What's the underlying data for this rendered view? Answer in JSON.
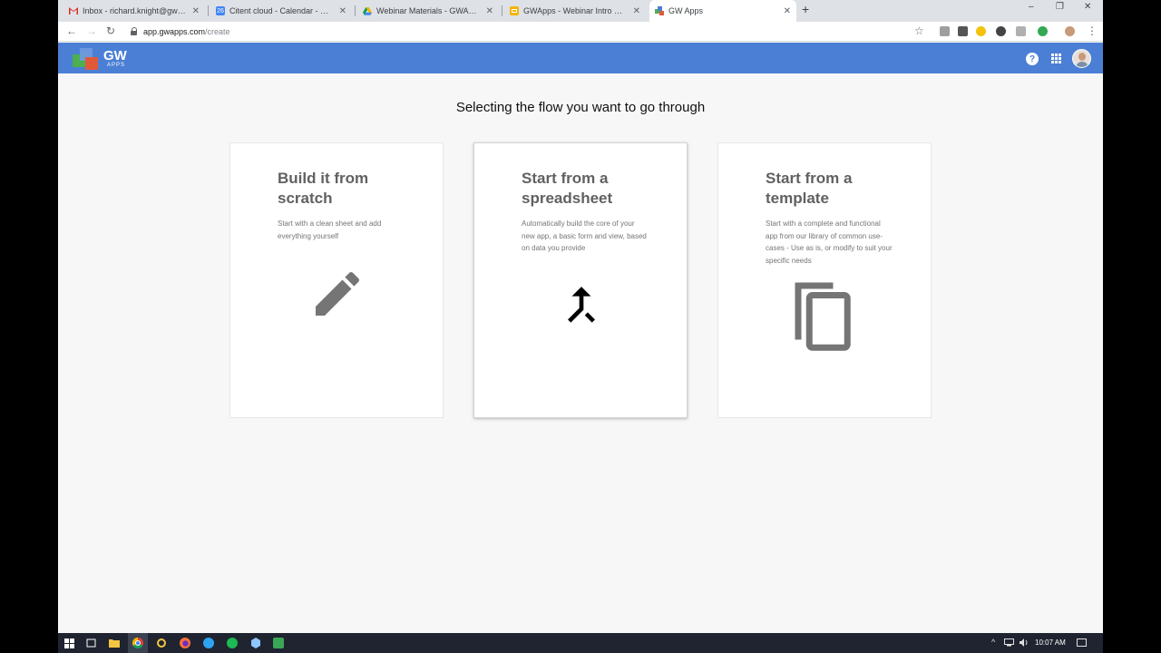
{
  "browser": {
    "tabs": [
      {
        "title": "Inbox - richard.knight@gwapps.c",
        "icon": "gmail-icon",
        "color": "#d93025",
        "active": false
      },
      {
        "title": "Citent cloud - Calendar - Week o",
        "icon": "calendar-icon",
        "color": "#4285f4",
        "active": false
      },
      {
        "title": "Webinar Materials - GWApps - S",
        "icon": "drive-icon",
        "color": "#f4b400",
        "active": false
      },
      {
        "title": "GWApps - Webinar Intro & Sale",
        "icon": "slides-icon",
        "color": "#f4b400",
        "active": false
      },
      {
        "title": "GW Apps",
        "icon": "gwapps-icon",
        "color": "#4a7fd5",
        "active": true
      }
    ],
    "tab_close_glyph": "✕",
    "new_tab_glyph": "+",
    "window_controls": {
      "minimize": "–",
      "restore": "❐",
      "close": "✕"
    },
    "nav": {
      "back": "←",
      "forward": "→",
      "reload": "↻"
    },
    "url": {
      "host": "app.gwapps.com",
      "path": "/create"
    },
    "bookmark_glyph": "☆"
  },
  "app": {
    "logo_text": "GW",
    "logo_sub": "APPS",
    "help_glyph": "?",
    "heading": "Selecting the flow you want to go through",
    "cards": [
      {
        "title": "Build it from scratch",
        "description": "Start with a clean sheet and add everything yourself",
        "icon": "pencil-icon"
      },
      {
        "title": "Start from a spreadsheet",
        "description": "Automatically build the core of your new app, a basic form and view, based on data you provide",
        "icon": "merge-icon"
      },
      {
        "title": "Start from a template",
        "description": "Start with a complete and functional app from our library of common use-cases - Use as is, or modify to suit your specific needs",
        "icon": "copy-icon"
      }
    ]
  },
  "taskbar": {
    "clock": "10:07 AM",
    "tray_up_glyph": "^"
  },
  "colors": {
    "app_header": "#4a7fd5",
    "icon_gray": "#757575"
  }
}
